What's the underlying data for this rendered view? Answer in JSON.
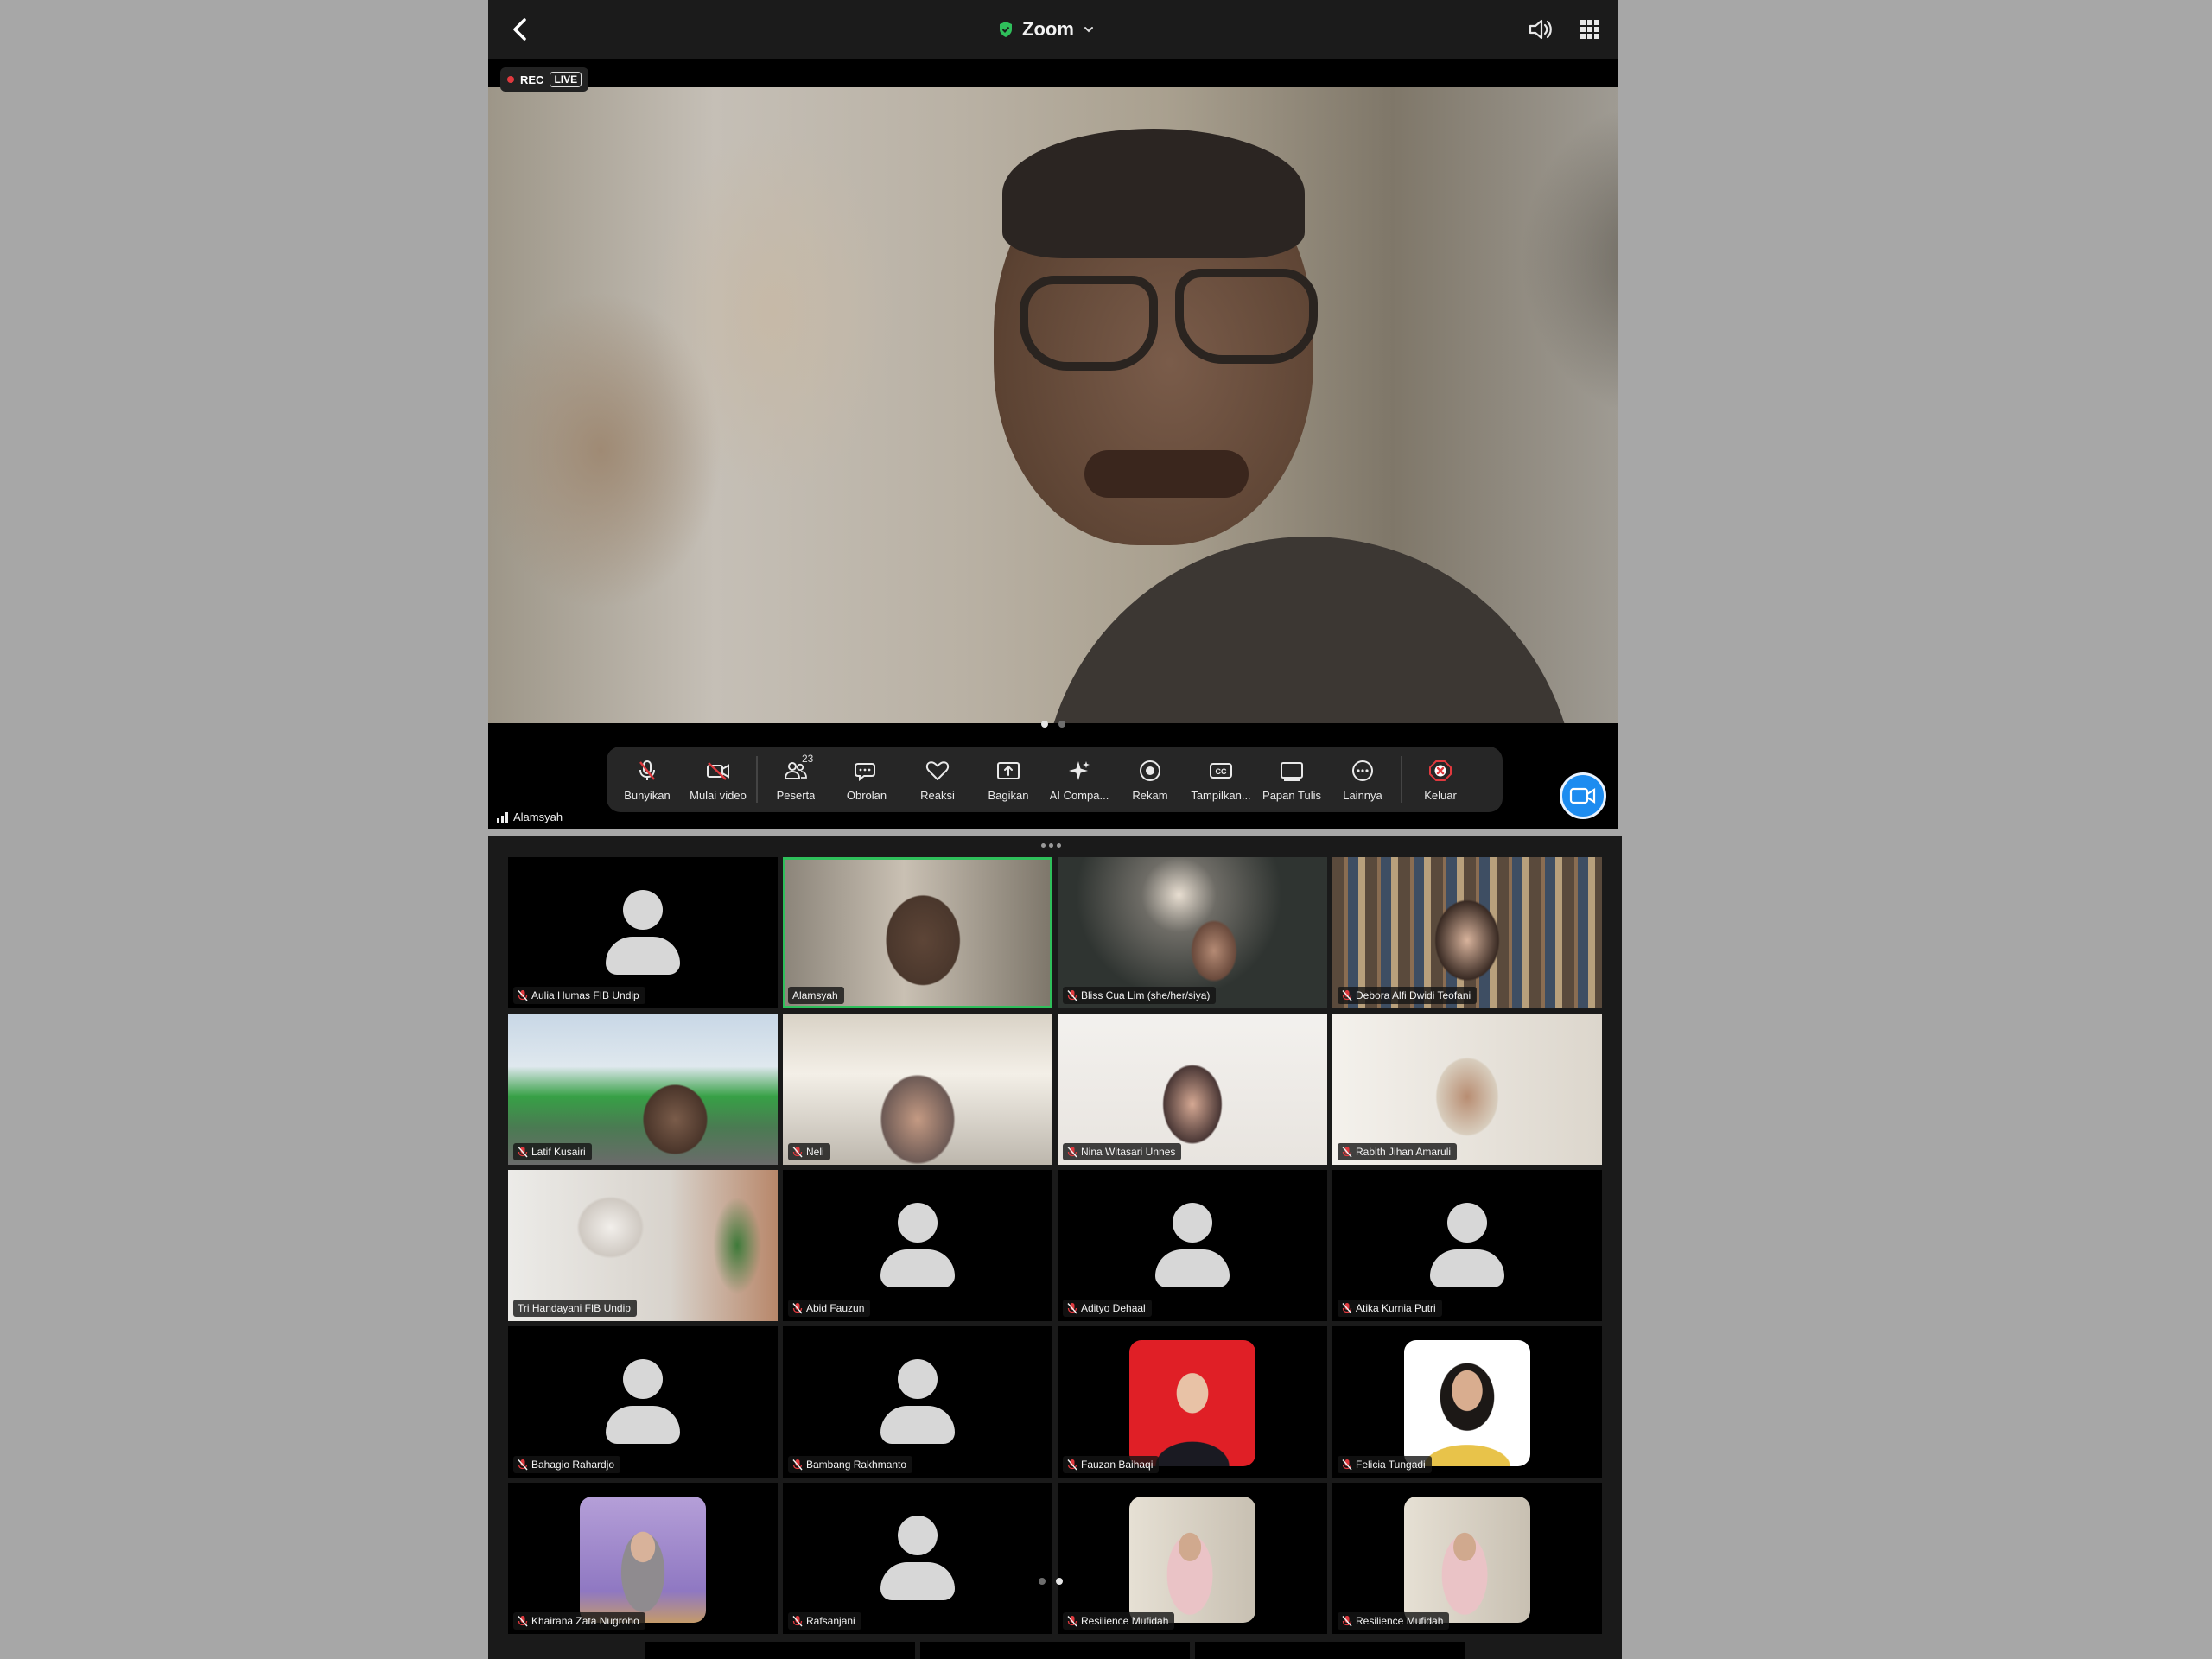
{
  "header": {
    "title": "Zoom",
    "rec_label": "REC",
    "live_label": "LIVE"
  },
  "main_video": {
    "speaker_name": "Alamsyah"
  },
  "toolbar": {
    "unmute": "Bunyikan",
    "start_video": "Mulai video",
    "participants": "Peserta",
    "participants_count": "23",
    "chat": "Obrolan",
    "reactions": "Reaksi",
    "share": "Bagikan",
    "ai_companion": "AI Compa...",
    "record": "Rekam",
    "captions": "Tampilkan...",
    "whiteboard": "Papan Tulis",
    "more": "Lainnya",
    "leave": "Keluar"
  },
  "gallery": {
    "tiles": [
      {
        "name": "Aulia Humas FIB Undip",
        "muted": true
      },
      {
        "name": "Alamsyah",
        "muted": false
      },
      {
        "name": "Bliss Cua Lim (she/her/siya)",
        "muted": true
      },
      {
        "name": "Debora Alfi Dwidi Teofani",
        "muted": true
      },
      {
        "name": "Latif Kusairi",
        "muted": true
      },
      {
        "name": "Neli",
        "muted": true
      },
      {
        "name": "Nina Witasari Unnes",
        "muted": true
      },
      {
        "name": "Rabith Jihan Amaruli",
        "muted": true
      },
      {
        "name": "Tri Handayani FIB Undip",
        "muted": false
      },
      {
        "name": "Abid Fauzun",
        "muted": true
      },
      {
        "name": "Adityo Dehaal",
        "muted": true
      },
      {
        "name": "Atika Kurnia Putri",
        "muted": true
      },
      {
        "name": "Bahagio Rahardjo",
        "muted": true
      },
      {
        "name": "Bambang Rakhmanto",
        "muted": true
      },
      {
        "name": "Fauzan Baihaqi",
        "muted": true
      },
      {
        "name": "Felicia Tungadi",
        "muted": true
      },
      {
        "name": "Khairana Zata Nugroho",
        "muted": true
      },
      {
        "name": "Rafsanjani",
        "muted": true
      },
      {
        "name": "Resilience Mufidah",
        "muted": true
      },
      {
        "name": "Resilience Mufidah",
        "muted": true
      }
    ]
  },
  "colors": {
    "accent_blue": "#1d8cf0",
    "active_speaker_border": "#2fbf5b",
    "mute_red": "#e0393e",
    "leave_red": "#e0393e"
  }
}
